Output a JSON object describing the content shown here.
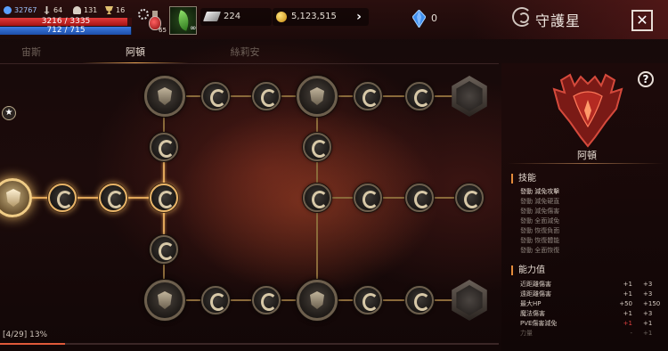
{
  "player": {
    "level": "32767",
    "attack": "64",
    "defense": "131",
    "wins": "16",
    "hp_text": "3216 / 3335",
    "hp_fraction": 0.964,
    "mp_text": "712 / 715",
    "mp_fraction": 0.996
  },
  "items": {
    "potion_count": "65",
    "herb_count": "∞"
  },
  "currency": {
    "silver": "224",
    "gold": "5,123,515",
    "gems": "0"
  },
  "header": {
    "title": "守護星",
    "close_symbol": "✕",
    "more_symbol": "›"
  },
  "tabs": [
    {
      "label": "宙斯",
      "active": false
    },
    {
      "label": "阿頓",
      "active": true
    },
    {
      "label": "絲莉安",
      "active": false
    }
  ],
  "side": {
    "help_symbol": "?",
    "crest_name": "阿頓",
    "skills_title": "技能",
    "skills": [
      {
        "label": "發動 減免攻擊",
        "active": true
      },
      {
        "label": "發動 減免硬直",
        "active": false
      },
      {
        "label": "發動 減免傷害",
        "active": false
      },
      {
        "label": "發動 全面減免",
        "active": false
      },
      {
        "label": "發動 恢復負面",
        "active": false
      },
      {
        "label": "發動 恢復體能",
        "active": false
      },
      {
        "label": "發動 全面恢復",
        "active": false
      }
    ],
    "attributes_title": "能力值",
    "attributes": [
      {
        "label": "近距離傷害",
        "current": "+1",
        "next": "+3",
        "dim": false,
        "current_red": false
      },
      {
        "label": "遠距離傷害",
        "current": "+1",
        "next": "+3",
        "dim": false,
        "current_red": false
      },
      {
        "label": "最大HP",
        "current": "+50",
        "next": "+150",
        "dim": false,
        "current_red": false
      },
      {
        "label": "魔法傷害",
        "current": "+1",
        "next": "+3",
        "dim": false,
        "current_red": false
      },
      {
        "label": "PVE傷害減免",
        "current": "+1",
        "next": "+1",
        "dim": false,
        "current_red": true
      },
      {
        "label": "力量",
        "current": "-",
        "next": "+1",
        "dim": true,
        "current_red": false
      }
    ]
  },
  "progress": {
    "text": "[4/29] 13%",
    "fraction": 0.13
  },
  "colors": {
    "accent": "#e3a050",
    "hp": "#c42222",
    "mp": "#2c62c4",
    "node_lit": "#e8b468"
  },
  "icons": {
    "star": "★"
  }
}
